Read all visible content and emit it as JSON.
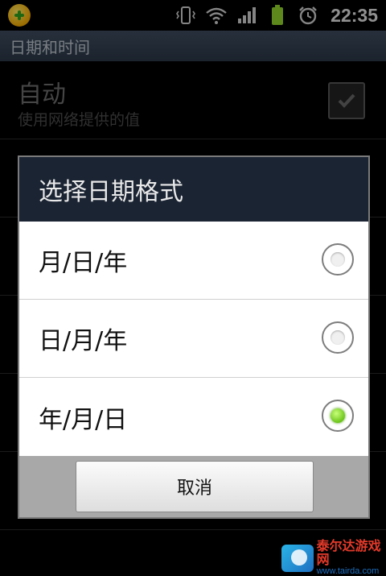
{
  "status_bar": {
    "time": "22:35",
    "icons": [
      "app-icon",
      "vibrate-icon",
      "wifi-icon",
      "signal-icon",
      "battery-icon",
      "alarm-icon"
    ]
  },
  "title_bar": {
    "title": "日期和时间"
  },
  "background_list": {
    "auto": {
      "title": "自动",
      "subtitle": "使用网络提供的值",
      "checked": true
    }
  },
  "dialog": {
    "title": "选择日期格式",
    "options": [
      {
        "label": "月/日/年",
        "selected": false
      },
      {
        "label": "日/月/年",
        "selected": false
      },
      {
        "label": "年/月/日",
        "selected": true
      }
    ],
    "cancel_label": "取消"
  },
  "watermark": {
    "name": "泰尔达游戏网",
    "url": "www.tairda.com"
  },
  "colors": {
    "accent": "#6cc51a",
    "dialog_title_bg": "#1b2433",
    "footer_bg": "#a8a8a8"
  }
}
